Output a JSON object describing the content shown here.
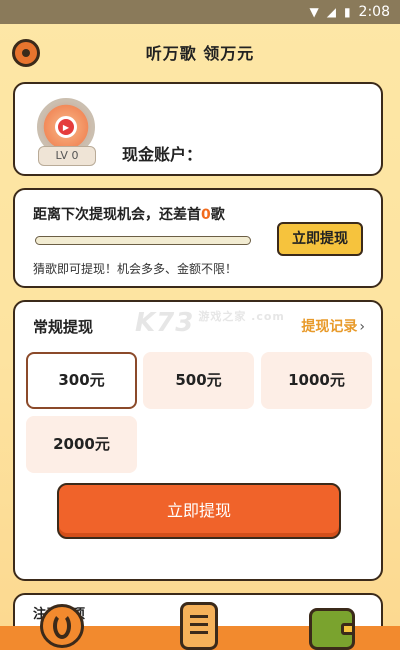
{
  "status_bar": {
    "time": "2:08"
  },
  "header": {
    "title": "听万歌 领万元",
    "settings_icon": "gear-icon"
  },
  "account": {
    "level_badge": "LV 0",
    "label": "现金账户："
  },
  "progress_card": {
    "text_prefix": "距离下次提现机会，还差首",
    "remaining_count": "0",
    "text_suffix": "歌",
    "progress_fraction": 0.0,
    "withdraw_button": "立即提现",
    "hint": "猜歌即可提现！机会多多、金额不限！"
  },
  "withdraw_card": {
    "title": "常规提现",
    "record_link": "提现记录",
    "amounts": [
      "300元",
      "500元",
      "1000元",
      "2000元"
    ],
    "selected_index": 0,
    "submit_button": "立即提现",
    "watermark": "K73",
    "watermark_sub": "游戏之家 .com"
  },
  "notice_card": {
    "title": "注意事项"
  },
  "tabbar": {
    "items": [
      "music-note-icon",
      "clipboard-list-icon",
      "wallet-icon"
    ]
  },
  "colors": {
    "background": "#fde7a6",
    "accent_orange": "#f0632a",
    "accent_yellow": "#f6c33d",
    "highlight_number": "#f26b1d",
    "record_link": "#e89a2a",
    "amount_tile": "#fdeee6"
  }
}
